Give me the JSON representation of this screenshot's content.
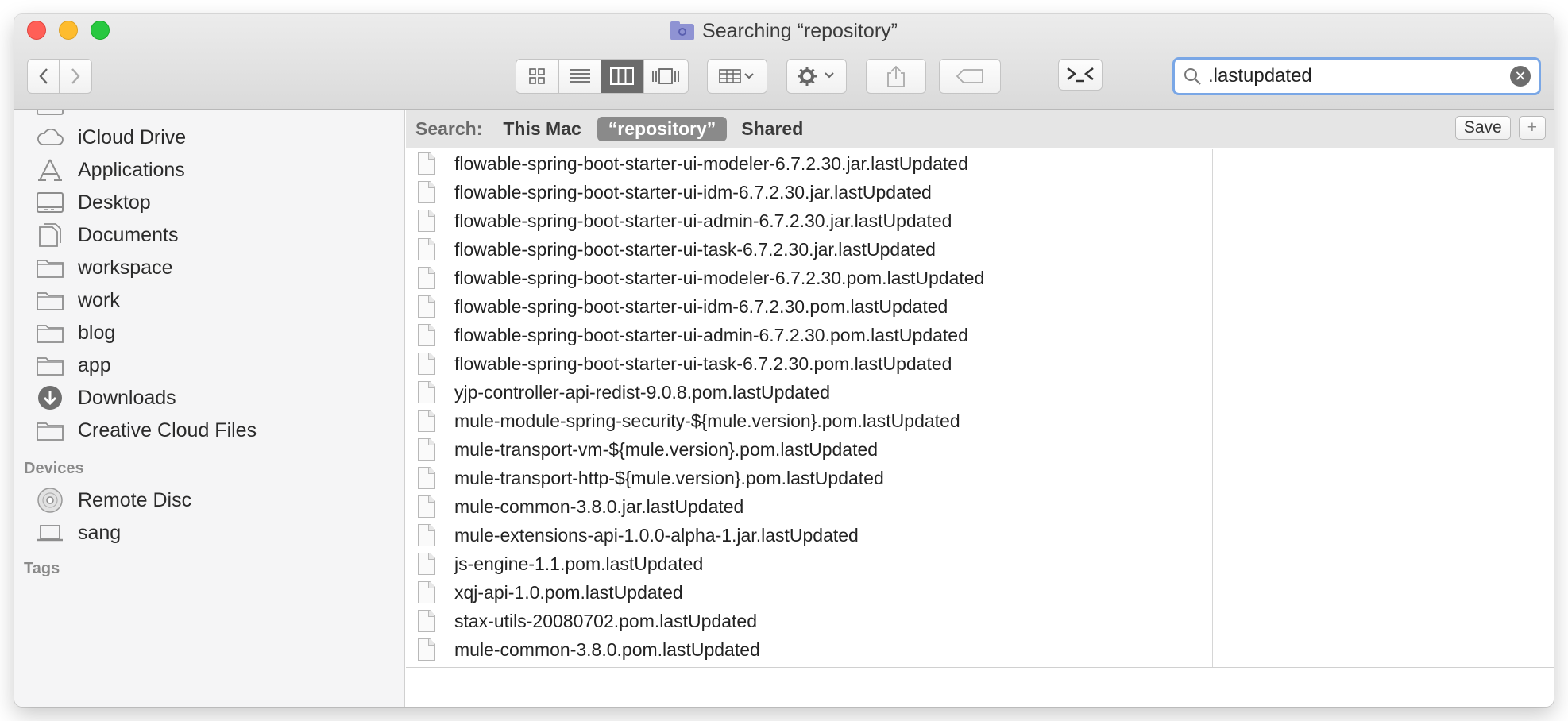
{
  "window": {
    "title": "Searching “repository”"
  },
  "toolbar": {
    "view_modes": [
      "icon-view",
      "list-view",
      "column-view",
      "coverflow-view"
    ],
    "active_view": "column-view"
  },
  "search": {
    "value": ".lastupdated",
    "placeholder": "Search"
  },
  "sidebar": {
    "items": [
      {
        "label": "iCloud Drive",
        "icon": "cloud-icon"
      },
      {
        "label": "Applications",
        "icon": "applications-icon"
      },
      {
        "label": "Desktop",
        "icon": "desktop-icon"
      },
      {
        "label": "Documents",
        "icon": "documents-icon"
      },
      {
        "label": "workspace",
        "icon": "folder-icon"
      },
      {
        "label": "work",
        "icon": "folder-icon"
      },
      {
        "label": "blog",
        "icon": "folder-icon"
      },
      {
        "label": "app",
        "icon": "folder-icon"
      },
      {
        "label": "Downloads",
        "icon": "downloads-icon"
      },
      {
        "label": "Creative Cloud Files",
        "icon": "folder-icon"
      }
    ],
    "devices_heading": "Devices",
    "devices": [
      {
        "label": "Remote Disc",
        "icon": "disc-icon"
      },
      {
        "label": "sang",
        "icon": "laptop-icon"
      }
    ],
    "tags_heading": "Tags"
  },
  "scope": {
    "label": "Search:",
    "options": [
      "This Mac",
      "“repository”",
      "Shared"
    ],
    "active": "“repository”",
    "save_label": "Save",
    "add_label": "+"
  },
  "files": [
    "flowable-spring-boot-starter-ui-modeler-6.7.2.30.jar.lastUpdated",
    "flowable-spring-boot-starter-ui-idm-6.7.2.30.jar.lastUpdated",
    "flowable-spring-boot-starter-ui-admin-6.7.2.30.jar.lastUpdated",
    "flowable-spring-boot-starter-ui-task-6.7.2.30.jar.lastUpdated",
    "flowable-spring-boot-starter-ui-modeler-6.7.2.30.pom.lastUpdated",
    "flowable-spring-boot-starter-ui-idm-6.7.2.30.pom.lastUpdated",
    "flowable-spring-boot-starter-ui-admin-6.7.2.30.pom.lastUpdated",
    "flowable-spring-boot-starter-ui-task-6.7.2.30.pom.lastUpdated",
    "yjp-controller-api-redist-9.0.8.pom.lastUpdated",
    "mule-module-spring-security-${mule.version}.pom.lastUpdated",
    "mule-transport-vm-${mule.version}.pom.lastUpdated",
    "mule-transport-http-${mule.version}.pom.lastUpdated",
    "mule-common-3.8.0.jar.lastUpdated",
    "mule-extensions-api-1.0.0-alpha-1.jar.lastUpdated",
    "js-engine-1.1.pom.lastUpdated",
    "xqj-api-1.0.pom.lastUpdated",
    "stax-utils-20080702.pom.lastUpdated",
    "mule-common-3.8.0.pom.lastUpdated"
  ]
}
